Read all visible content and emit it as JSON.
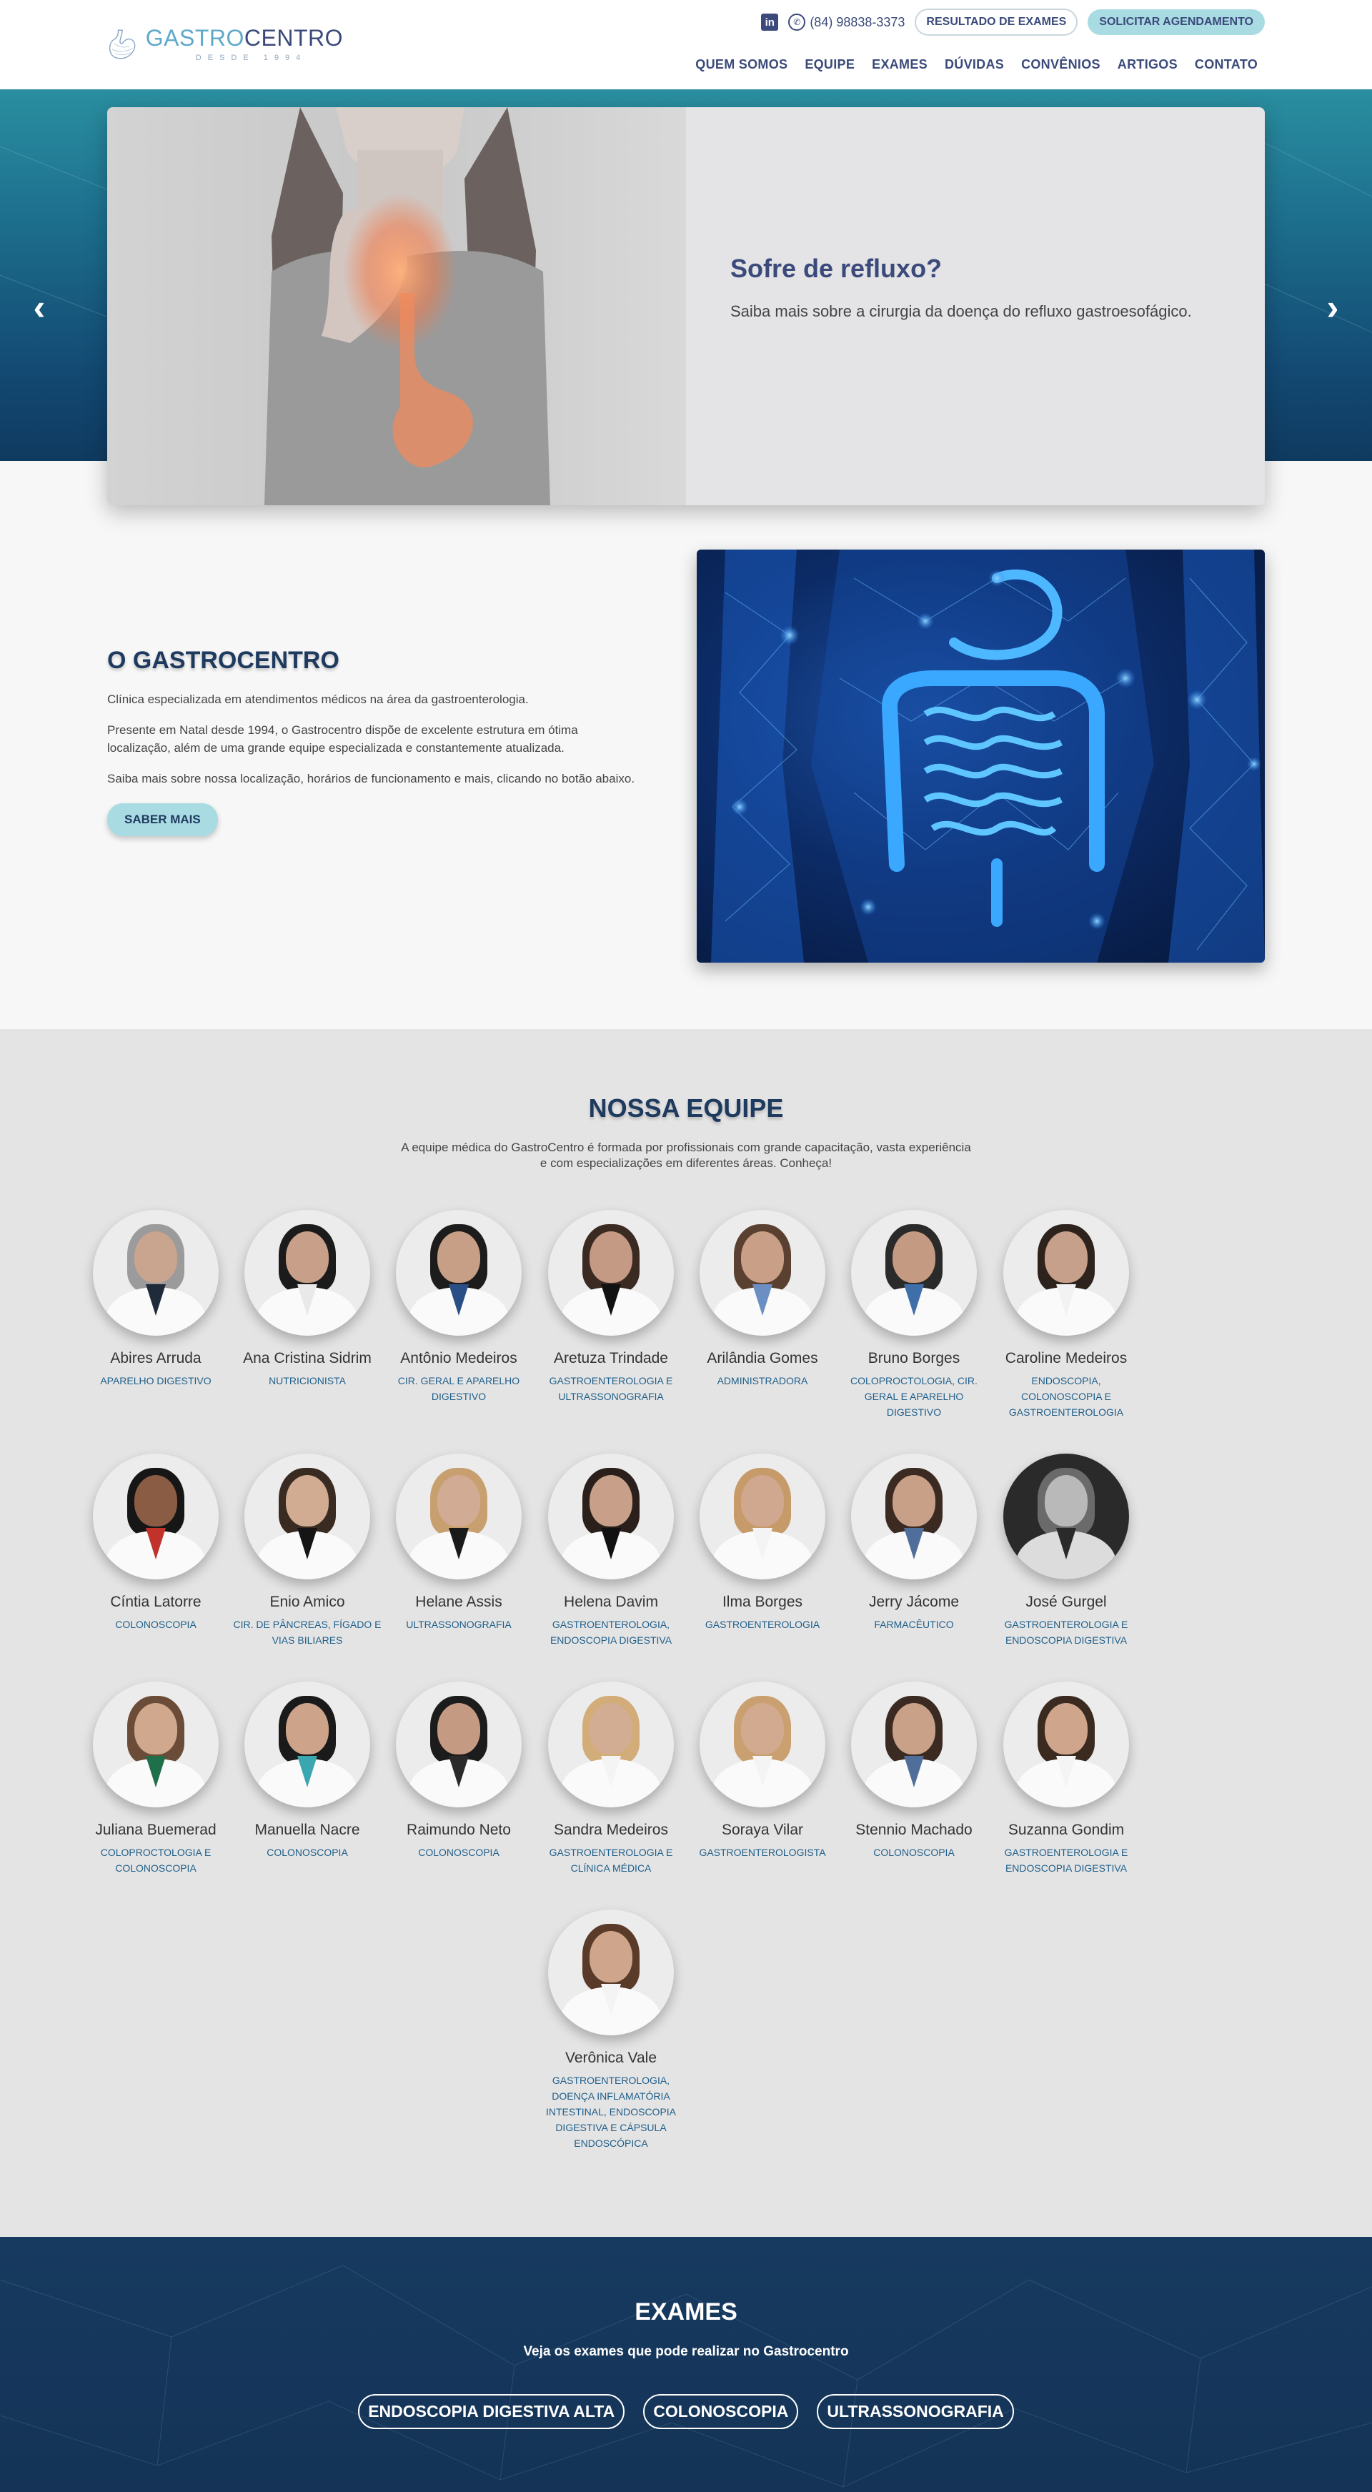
{
  "header": {
    "logo": {
      "name_light": "GASTRO",
      "name_bold": "CENTRO",
      "since": "DESDE 1994"
    },
    "linkedin_icon": "in",
    "phone": "(84) 98838-3373",
    "results_button": "RESULTADO DE EXAMES",
    "schedule_button": "SOLICITAR AGENDAMENTO",
    "nav": [
      "QUEM SOMOS",
      "EQUIPE",
      "EXAMES",
      "DÚVIDAS",
      "CONVÊNIOS",
      "ARTIGOS",
      "CONTATO"
    ]
  },
  "hero": {
    "prev_icon": "chevron-left-icon",
    "next_icon": "chevron-right-icon",
    "title": "Sofre de refluxo?",
    "subtitle": "Saiba mais sobre a cirurgia da doença do refluxo gastroesofágico."
  },
  "about": {
    "title": "O GASTROCENTRO",
    "p1": "Clínica especializada em atendimentos médicos na área da gastroenterologia.",
    "p2": "Presente em Natal desde 1994, o Gastrocentro dispõe de excelente estrutura em ótima localização, além de uma grande equipe especializada e constantemente atualizada.",
    "p3": "Saiba mais sobre nossa localização, horários de funcionamento e mais, clicando no botão abaixo.",
    "button": "SABER MAIS"
  },
  "team": {
    "title": "NOSSA EQUIPE",
    "subtitle": "A equipe médica do GastroCentro é formada por profissionais com grande capacitação, vasta experiência e com especializações em diferentes áreas. Conheça!",
    "members": [
      {
        "name": "Abires Arruda",
        "role": "APARELHO DIGESTIVO"
      },
      {
        "name": "Ana Cristina Sidrim",
        "role": "NUTRICIONISTA"
      },
      {
        "name": "Antônio Medeiros",
        "role": "CIR. GERAL E APARELHO DIGESTIVO"
      },
      {
        "name": "Aretuza Trindade",
        "role": "GASTROENTEROLOGIA E ULTRASSONOGRAFIA"
      },
      {
        "name": "Arilândia Gomes",
        "role": "ADMINISTRADORA"
      },
      {
        "name": "Bruno Borges",
        "role": "COLOPROCTOLOGIA, CIR. GERAL E APARELHO DIGESTIVO"
      },
      {
        "name": "Caroline Medeiros",
        "role": "ENDOSCOPIA, COLONOSCOPIA E GASTROENTEROLOGIA"
      },
      {
        "name": "Cíntia Latorre",
        "role": "COLONOSCOPIA"
      },
      {
        "name": "Enio Amico",
        "role": "CIR. DE PÂNCREAS, FÍGADO E VIAS BILIARES"
      },
      {
        "name": "Helane Assis",
        "role": "ULTRASSONOGRAFIA"
      },
      {
        "name": "Helena Davim",
        "role": "GASTROENTEROLOGIA, ENDOSCOPIA DIGESTIVA"
      },
      {
        "name": "Ilma Borges",
        "role": "GASTROENTEROLOGIA"
      },
      {
        "name": "Jerry Jácome",
        "role": "FARMACÊUTICO"
      },
      {
        "name": "José Gurgel",
        "role": "GASTROENTEROLOGIA E ENDOSCOPIA DIGESTIVA"
      },
      {
        "name": "Juliana Buemerad",
        "role": "COLOPROCTOLOGIA E COLONOSCOPIA"
      },
      {
        "name": "Manuella Nacre",
        "role": "COLONOSCOPIA"
      },
      {
        "name": "Raimundo Neto",
        "role": "COLONOSCOPIA"
      },
      {
        "name": "Sandra Medeiros",
        "role": "GASTROENTEROLOGIA E CLÍNICA MÉDICA"
      },
      {
        "name": "Soraya Vilar",
        "role": "GASTROENTEROLOGISTA"
      },
      {
        "name": "Stennio Machado",
        "role": "COLONOSCOPIA"
      },
      {
        "name": "Suzanna Gondim",
        "role": "GASTROENTEROLOGIA E ENDOSCOPIA DIGESTIVA"
      },
      {
        "name": "Verônica Vale",
        "role": "GASTROENTEROLOGIA, DOENÇA INFLAMATÓRIA INTESTINAL, ENDOSCOPIA DIGESTIVA E CÁPSULA ENDOSCÓPICA"
      }
    ]
  },
  "exams": {
    "title": "EXAMES",
    "subtitle": "Veja os exames que pode realizar no Gastrocentro",
    "buttons": [
      "ENDOSCOPIA DIGESTIVA ALTA",
      "COLONOSCOPIA",
      "ULTRASSONOGRAFIA"
    ]
  }
}
